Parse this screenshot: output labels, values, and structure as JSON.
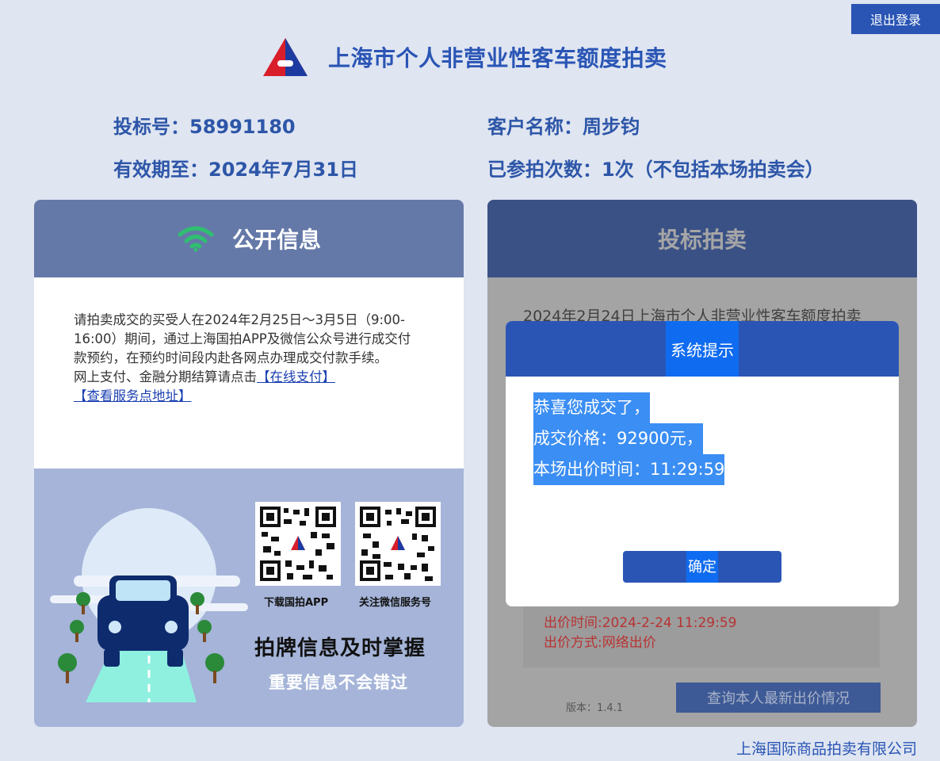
{
  "header": {
    "logout_label": "退出登录",
    "title": "上海市个人非营业性客车额度拍卖"
  },
  "user_info": {
    "bid_number": "投标号：58991180",
    "customer_name": "客户名称：周步钧",
    "valid_until": "有效期至：2024年7月31日",
    "participation_count": "已参拍次数：1次（不包括本场拍卖会）"
  },
  "left_panel": {
    "title": "公开信息",
    "notice_p1": "请拍卖成交的买受人在2024年2月25日～3月5日（9:00-16:00）期间，通过上海国拍APP及微信公众号进行成交付款预约，在预约时间段内赴各网点办理成交付款手续。",
    "notice_p2": "网上支付、金融分期结算请点击",
    "link_pay": "【在线支付】",
    "link_address": "【查看服务点地址】",
    "qr_app_label": "下载国拍APP",
    "qr_wechat_label": "关注微信服务号",
    "promo_line1": "拍牌信息及时掌握",
    "promo_line2": "重要信息不会错过"
  },
  "right_panel": {
    "title": "投标拍卖",
    "subtitle": "2024年2月24日上海市个人非营业性客车额度拍卖",
    "bid_time": "出价时间:2024-2-24 11:29:59",
    "bid_method": "出价方式:网络出价",
    "version": "版本：1.4.1",
    "query_label": "查询本人最新出价情况"
  },
  "dialog": {
    "title": "系统提示",
    "line1": "恭喜您成交了，",
    "line2": "成交价格：92900元，",
    "line3": "本场出价时间：11:29:59",
    "ok_label": "确定"
  },
  "footer": {
    "company": "上海国际商品拍卖有限公司"
  },
  "colors": {
    "brand_blue": "#2a55b5",
    "page_bg": "#dfe5f1",
    "selection": "#3b8ef3",
    "alert_red": "#b83333"
  }
}
